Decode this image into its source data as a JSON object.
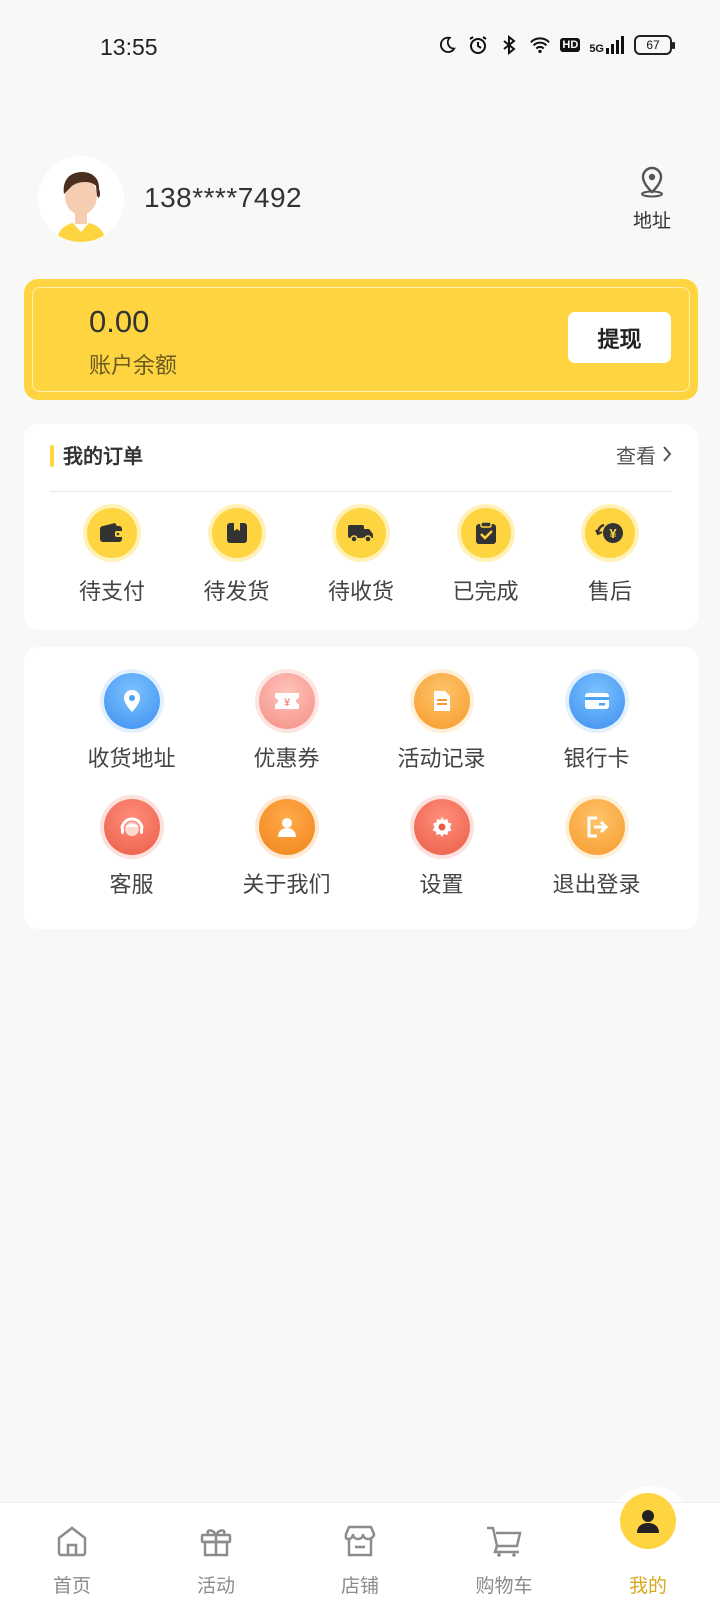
{
  "status_bar": {
    "time": "13:55",
    "hd_badge": "HD",
    "network": "5G",
    "battery": "67",
    "icons": [
      "moon-icon",
      "alarm-icon",
      "bluetooth-icon",
      "wifi-icon",
      "hd-badge",
      "signal-icon",
      "battery-icon"
    ]
  },
  "profile": {
    "phone": "138****7492",
    "address_label": "地址",
    "address_icon": "location-pin-icon"
  },
  "balance": {
    "value": "0.00",
    "label": "账户余额",
    "withdraw_label": "提现"
  },
  "orders": {
    "title": "我的订单",
    "view_label": "查看",
    "items": [
      {
        "label": "待支付",
        "icon": "wallet-icon"
      },
      {
        "label": "待发货",
        "icon": "box-icon"
      },
      {
        "label": "待收货",
        "icon": "truck-icon"
      },
      {
        "label": "已完成",
        "icon": "clipboard-check-icon"
      },
      {
        "label": "售后",
        "icon": "yen-refund-icon"
      }
    ]
  },
  "services": {
    "items": [
      {
        "label": "收货地址",
        "icon": "location-icon",
        "color": "#4aa3f5"
      },
      {
        "label": "优惠券",
        "icon": "coupon-icon",
        "color": "#f7a39a"
      },
      {
        "label": "活动记录",
        "icon": "document-icon",
        "color": "#f9a03c"
      },
      {
        "label": "银行卡",
        "icon": "card-icon",
        "color": "#4aa3f5"
      },
      {
        "label": "客服",
        "icon": "customer-service-icon",
        "color": "#f06a55"
      },
      {
        "label": "关于我们",
        "icon": "user-icon",
        "color": "#f58c22"
      },
      {
        "label": "设置",
        "icon": "gear-icon",
        "color": "#f06a55"
      },
      {
        "label": "退出登录",
        "icon": "logout-icon",
        "color": "#f9a03c"
      }
    ]
  },
  "tabbar": {
    "items": [
      {
        "label": "首页",
        "icon": "home-icon"
      },
      {
        "label": "活动",
        "icon": "gift-icon"
      },
      {
        "label": "店铺",
        "icon": "store-icon"
      },
      {
        "label": "购物车",
        "icon": "cart-icon"
      },
      {
        "label": "我的",
        "icon": "user-icon",
        "active": true
      }
    ],
    "active_color": "#d9a81c"
  },
  "colors": {
    "accent": "#fed541",
    "background": "#f8f8f7"
  }
}
